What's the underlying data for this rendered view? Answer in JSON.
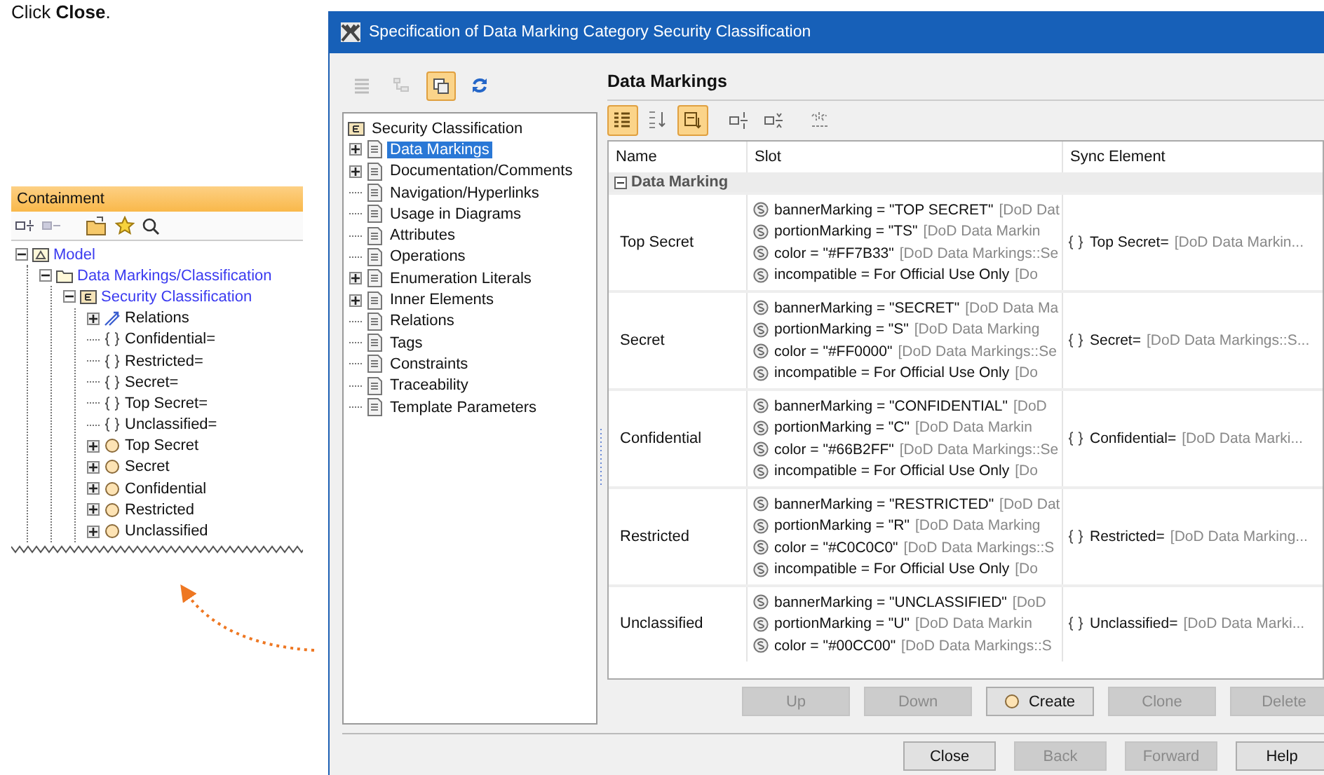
{
  "instruction": "Click **Close**.",
  "containment": {
    "title": "Containment",
    "tree": [
      {
        "label": "Model",
        "kind": "model",
        "expanded": true,
        "linked": true,
        "children": [
          {
            "label": "Data Markings/Classification",
            "kind": "folder",
            "expanded": true,
            "linked": true,
            "children": [
              {
                "label": "Security Classification",
                "kind": "class",
                "expanded": true,
                "linked": true,
                "children": [
                  {
                    "label": "Relations",
                    "kind": "relations",
                    "expanded": false,
                    "linked": false
                  },
                  {
                    "label": "Confidential=",
                    "kind": "slot",
                    "linked": false
                  },
                  {
                    "label": "Restricted=",
                    "kind": "slot",
                    "linked": false
                  },
                  {
                    "label": "Secret=",
                    "kind": "slot",
                    "linked": false
                  },
                  {
                    "label": "Top Secret=",
                    "kind": "slot",
                    "linked": false
                  },
                  {
                    "label": "Unclassified=",
                    "kind": "slot",
                    "linked": false
                  },
                  {
                    "label": "Top Secret",
                    "kind": "instance",
                    "expanded": false,
                    "linked": false
                  },
                  {
                    "label": "Secret",
                    "kind": "instance",
                    "expanded": false,
                    "linked": false
                  },
                  {
                    "label": "Confidential",
                    "kind": "instance",
                    "expanded": false,
                    "linked": false
                  },
                  {
                    "label": "Restricted",
                    "kind": "instance",
                    "expanded": false,
                    "linked": false
                  },
                  {
                    "label": "Unclassified",
                    "kind": "instance",
                    "expanded": false,
                    "linked": false
                  }
                ]
              }
            ]
          }
        ]
      }
    ]
  },
  "dialog": {
    "title": "Specification of Data Marking Category Security Classification",
    "left_toolbar": [
      {
        "disabled": true,
        "on": false
      },
      {
        "disabled": true,
        "on": false
      },
      {
        "disabled": false,
        "on": true
      },
      {
        "disabled": false,
        "on": false
      }
    ],
    "spec_tree": {
      "label": "Security Classification",
      "children": [
        {
          "label": "Data Markings",
          "expanded": false,
          "selected": true
        },
        {
          "label": "Documentation/Comments",
          "expanded": false,
          "selected": false
        },
        {
          "label": "Navigation/Hyperlinks",
          "selected": false
        },
        {
          "label": "Usage in Diagrams",
          "selected": false
        },
        {
          "label": "Attributes",
          "selected": false
        },
        {
          "label": "Operations",
          "selected": false
        },
        {
          "label": "Enumeration Literals",
          "expanded": false,
          "selected": false
        },
        {
          "label": "Inner Elements",
          "expanded": false,
          "selected": false
        },
        {
          "label": "Relations",
          "selected": false
        },
        {
          "label": "Tags",
          "selected": false
        },
        {
          "label": "Constraints",
          "selected": false
        },
        {
          "label": "Traceability",
          "selected": false
        },
        {
          "label": "Template Parameters",
          "selected": false
        }
      ]
    },
    "panel_title": "Data Markings",
    "table_toolbar": [
      {
        "on": true
      },
      {
        "on": false
      },
      {
        "on": true
      },
      {
        "on": false
      },
      {
        "on": false
      },
      {
        "on": false
      }
    ],
    "table": {
      "columns": [
        "Name",
        "Slot",
        "Sync Element"
      ],
      "group": {
        "label": "Data Marking",
        "expanded": true
      },
      "rows": [
        {
          "name": "Top Secret",
          "slots": [
            {
              "text": "bannerMarking = \"TOP SECRET\"",
              "type": "[DoD Dat"
            },
            {
              "text": "portionMarking = \"TS\"",
              "type": "[DoD Data Markin"
            },
            {
              "text": "color = \"#FF7B33\"",
              "type": "[DoD Data Markings::Se"
            },
            {
              "text": "incompatible = For Official Use Only",
              "type": "[Do"
            }
          ],
          "sync": {
            "text": "Top Secret=",
            "type": "[DoD Data Markin..."
          }
        },
        {
          "name": "Secret",
          "slots": [
            {
              "text": "bannerMarking = \"SECRET\"",
              "type": "[DoD Data Ma"
            },
            {
              "text": "portionMarking = \"S\"",
              "type": "[DoD Data Marking"
            },
            {
              "text": "color = \"#FF0000\"",
              "type": "[DoD Data Markings::Se"
            },
            {
              "text": "incompatible = For Official Use Only",
              "type": "[Do"
            }
          ],
          "sync": {
            "text": "Secret=",
            "type": "[DoD Data Markings::S..."
          }
        },
        {
          "name": "Confidential",
          "slots": [
            {
              "text": "bannerMarking = \"CONFIDENTIAL\"",
              "type": "[DoD"
            },
            {
              "text": "portionMarking = \"C\"",
              "type": "[DoD Data Markin"
            },
            {
              "text": "color = \"#66B2FF\"",
              "type": "[DoD Data Markings::Se"
            },
            {
              "text": "incompatible = For Official Use Only",
              "type": "[Do"
            }
          ],
          "sync": {
            "text": "Confidential=",
            "type": "[DoD Data Marki..."
          }
        },
        {
          "name": "Restricted",
          "slots": [
            {
              "text": "bannerMarking = \"RESTRICTED\"",
              "type": "[DoD Dat"
            },
            {
              "text": "portionMarking = \"R\"",
              "type": "[DoD Data Marking"
            },
            {
              "text": "color = \"#C0C0C0\"",
              "type": "[DoD Data Markings::S"
            },
            {
              "text": "incompatible = For Official Use Only",
              "type": "[Do"
            }
          ],
          "sync": {
            "text": "Restricted=",
            "type": "[DoD Data Marking..."
          }
        },
        {
          "name": "Unclassified",
          "slots": [
            {
              "text": "bannerMarking = \"UNCLASSIFIED\"",
              "type": "[DoD"
            },
            {
              "text": "portionMarking = \"U\"",
              "type": "[DoD Data Markin"
            },
            {
              "text": "color = \"#00CC00\"",
              "type": "[DoD Data Markings::S"
            }
          ],
          "sync": {
            "text": "Unclassified=",
            "type": "[DoD Data Marki..."
          }
        }
      ]
    },
    "table_buttons": [
      {
        "label": "Up",
        "kind": "plain",
        "disabled": true
      },
      {
        "label": "Down",
        "kind": "plain",
        "disabled": true
      },
      {
        "label": "Create",
        "kind": "create",
        "disabled": false
      },
      {
        "label": "Clone",
        "kind": "plain",
        "disabled": true
      },
      {
        "label": "Delete",
        "kind": "plain",
        "disabled": true
      }
    ],
    "footer_buttons": [
      {
        "label": "Close",
        "disabled": false
      },
      {
        "label": "Back",
        "disabled": true
      },
      {
        "label": "Forward",
        "disabled": true
      },
      {
        "label": "Help",
        "disabled": false
      }
    ]
  }
}
